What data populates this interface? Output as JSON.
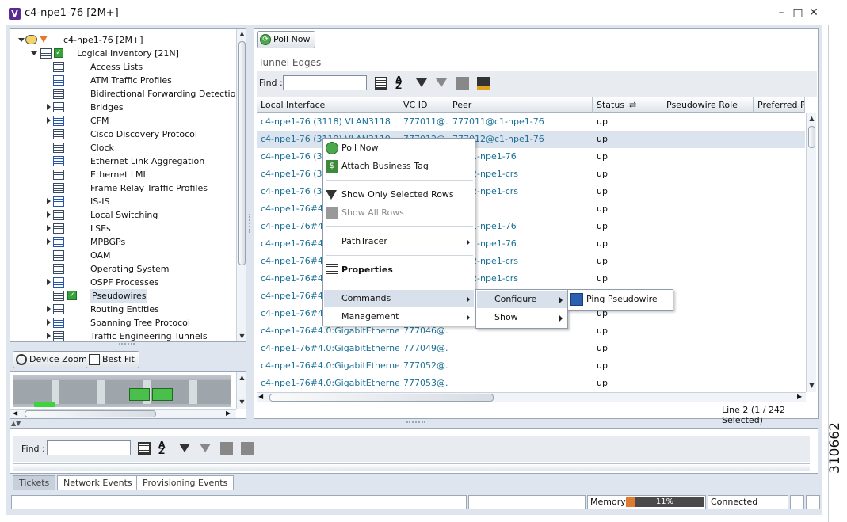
{
  "window": {
    "title": "c4-npe1-76 [2M+]",
    "app_icon_letter": "V",
    "side_label": "310662"
  },
  "tree": {
    "root_label": "c4-npe1-76 [2M+]",
    "inventory_label": "Logical Inventory [21N]",
    "items": [
      {
        "label": "Access Lists",
        "expandable": false
      },
      {
        "label": "ATM Traffic Profiles",
        "expandable": false
      },
      {
        "label": "Bidirectional Forwarding Detection",
        "expandable": false
      },
      {
        "label": "Bridges",
        "expandable": true
      },
      {
        "label": "CFM",
        "expandable": true
      },
      {
        "label": "Cisco Discovery Protocol",
        "expandable": false
      },
      {
        "label": "Clock",
        "expandable": false
      },
      {
        "label": "Ethernet Link Aggregation",
        "expandable": false
      },
      {
        "label": "Ethernet LMI",
        "expandable": false
      },
      {
        "label": "Frame Relay Traffic Profiles",
        "expandable": false
      },
      {
        "label": "IS-IS",
        "expandable": true
      },
      {
        "label": "Local Switching",
        "expandable": true
      },
      {
        "label": "LSEs",
        "expandable": true
      },
      {
        "label": "MPBGPs",
        "expandable": true
      },
      {
        "label": "OAM",
        "expandable": false
      },
      {
        "label": "Operating System",
        "expandable": false
      },
      {
        "label": "OSPF Processes",
        "expandable": true
      },
      {
        "label": "Pseudowires",
        "expandable": false,
        "checked": true
      },
      {
        "label": "Routing Entities",
        "expandable": true
      },
      {
        "label": "Spanning Tree Protocol",
        "expandable": true
      },
      {
        "label": "Traffic Engineering Tunnels",
        "expandable": true
      }
    ]
  },
  "map_buttons": {
    "device_zoom": "Device Zoom",
    "best_fit": "Best Fit"
  },
  "main": {
    "poll_now": "Poll Now",
    "section_title": "Tunnel Edges",
    "find_label": "Find :",
    "find_value": "",
    "columns": [
      "Local Interface",
      "VC ID",
      "Peer",
      "Status",
      "Pseudowire Role",
      "Preferred Pa"
    ],
    "rows": [
      {
        "iface": "c4-npe1-76 (3118) VLAN3118",
        "vcid": "777011@...",
        "peer": "777011@c1-npe1-76",
        "status": "up",
        "warn": false
      },
      {
        "iface": "c4-npe1-76 (3119) VLAN3119",
        "vcid": "777012@...",
        "peer": "777012@c1-npe1-76",
        "status": "up",
        "warn": true,
        "selected": true
      },
      {
        "iface": "c4-npe1-76 (312",
        "vcid": "",
        "peer": "0@c1-npe1-76",
        "status": "up",
        "warn": false
      },
      {
        "iface": "c4-npe1-76 (312",
        "vcid": "",
        "peer": "3@c2-npe1-crs",
        "status": "up",
        "warn": false
      },
      {
        "iface": "c4-npe1-76 (312",
        "vcid": "",
        "peer": "4@c2-npe1-crs",
        "status": "up",
        "warn": false
      },
      {
        "iface": "c4-npe1-76#4.0",
        "vcid": "",
        "peer": "",
        "status": "up",
        "warn": false
      },
      {
        "iface": "c4-npe1-76#4.0",
        "vcid": "",
        "peer": "3@c1-npe1-76",
        "status": "up",
        "warn": false
      },
      {
        "iface": "c4-npe1-76#4.0",
        "vcid": "",
        "peer": "4@c1-npe1-76",
        "status": "up",
        "warn": false
      },
      {
        "iface": "c4-npe1-76#4.0",
        "vcid": "",
        "peer": "1@c2-npe1-crs",
        "status": "up",
        "warn": false
      },
      {
        "iface": "c4-npe1-76#4.0",
        "vcid": "",
        "peer": "2@c2-npe1-crs",
        "status": "up",
        "warn": false
      },
      {
        "iface": "c4-npe1-76#4.0",
        "vcid": "",
        "peer": "",
        "status": "up",
        "warn": false
      },
      {
        "iface": "c4-npe1-76#4.0",
        "vcid": "",
        "peer": "",
        "status": "up",
        "warn": false
      },
      {
        "iface": "c4-npe1-76#4.0:GigabitEthernet...",
        "vcid": "777046@...",
        "peer": "",
        "status": "up",
        "warn": true
      },
      {
        "iface": "c4-npe1-76#4.0:GigabitEthernet...",
        "vcid": "777049@...",
        "peer": "",
        "status": "up",
        "warn": true
      },
      {
        "iface": "c4-npe1-76#4.0:GigabitEthernet...",
        "vcid": "777052@...",
        "peer": "",
        "status": "up",
        "warn": true
      },
      {
        "iface": "c4-npe1-76#4.0:GigabitEthernet...",
        "vcid": "777053@...",
        "peer": "",
        "status": "up",
        "warn": true
      }
    ],
    "line_status": "Line 2 (1 / 242 Selected)"
  },
  "context_menu": {
    "items": {
      "poll_now": "Poll Now",
      "attach_tag": "Attach Business Tag",
      "show_selected": "Show Only Selected Rows",
      "show_all": "Show All Rows",
      "pathtracer": "PathTracer",
      "properties": "Properties",
      "commands": "Commands",
      "management": "Management"
    },
    "submenu": {
      "configure": "Configure",
      "show": "Show"
    },
    "subsubmenu": {
      "ping": "Ping Pseudowire"
    }
  },
  "bottom": {
    "find_label": "Find :",
    "find_value": "",
    "tabs": [
      "Tickets",
      "Network Events",
      "Provisioning Events"
    ]
  },
  "statusbar": {
    "memory_label": "Memory:",
    "memory_value": "11%",
    "memory_fraction": 0.11,
    "connection": "Connected"
  },
  "colors": {
    "frame": "#dee5ee",
    "link": "#1a6f96",
    "selection": "#dbe3ee",
    "memory_fill": "#e07a2f"
  }
}
